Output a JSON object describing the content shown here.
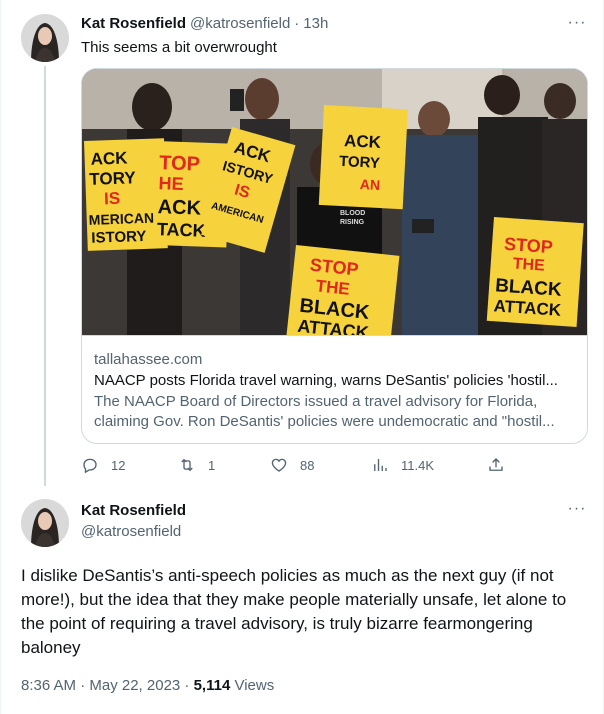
{
  "tweets": [
    {
      "author_name": "Kat Rosenfield",
      "handle": "@katrosenfield",
      "separator": "·",
      "time": "13h",
      "text": "This seems a bit overwrought",
      "link_card": {
        "domain": "tallahassee.com",
        "title": "NAACP posts Florida travel warning, warns DeSantis' policies 'hostil...",
        "description": "The NAACP Board of Directors issued a travel advisory for Florida, claiming Gov. Ron DeSantis' policies were undemocratic and \"hostil...",
        "photo_signs": {
          "sign1": [
            "ACK",
            "TORY",
            "IS",
            "MERICAN",
            "ISTORY"
          ],
          "sign2": [
            "TOP",
            "HE",
            "ACK",
            "TACK"
          ],
          "sign3": [
            "ACK",
            "ISTORY",
            "IS",
            "AMERICAN"
          ],
          "sign4": [
            "ACK",
            "TORY",
            "AN"
          ],
          "sign5": [
            "STOP",
            "THE",
            "BLACK",
            "ATTACK"
          ],
          "sign6": [
            "STOP",
            "THE",
            "BLACK",
            "ATTACK"
          ],
          "shirt": [
            "BLOOD",
            "RISING"
          ]
        }
      },
      "actions": {
        "replies": "12",
        "retweets": "1",
        "likes": "88",
        "views": "11.4K"
      }
    },
    {
      "author_name": "Kat Rosenfield",
      "handle": "@katrosenfield",
      "text": "I dislike DeSantis’s anti-speech policies as much as the next guy (if not more!), but the idea that they make people materially unsafe, let alone to the point of requiring a travel advisory, is truly bizarre fearmongering baloney",
      "timestamp": "8:36 AM · May 22, 2023 · ",
      "views_count": "5,114",
      "views_label": " Views"
    }
  ],
  "icons": {
    "reply": "reply-icon",
    "retweet": "retweet-icon",
    "like": "heart-icon",
    "views": "analytics-icon",
    "share": "share-icon",
    "more": "more-icon"
  },
  "colors": {
    "text_primary": "#0f1419",
    "text_secondary": "#536471",
    "border": "#cfd9de",
    "sign_yellow": "#f6d23c",
    "sign_red": "#e0281f"
  }
}
